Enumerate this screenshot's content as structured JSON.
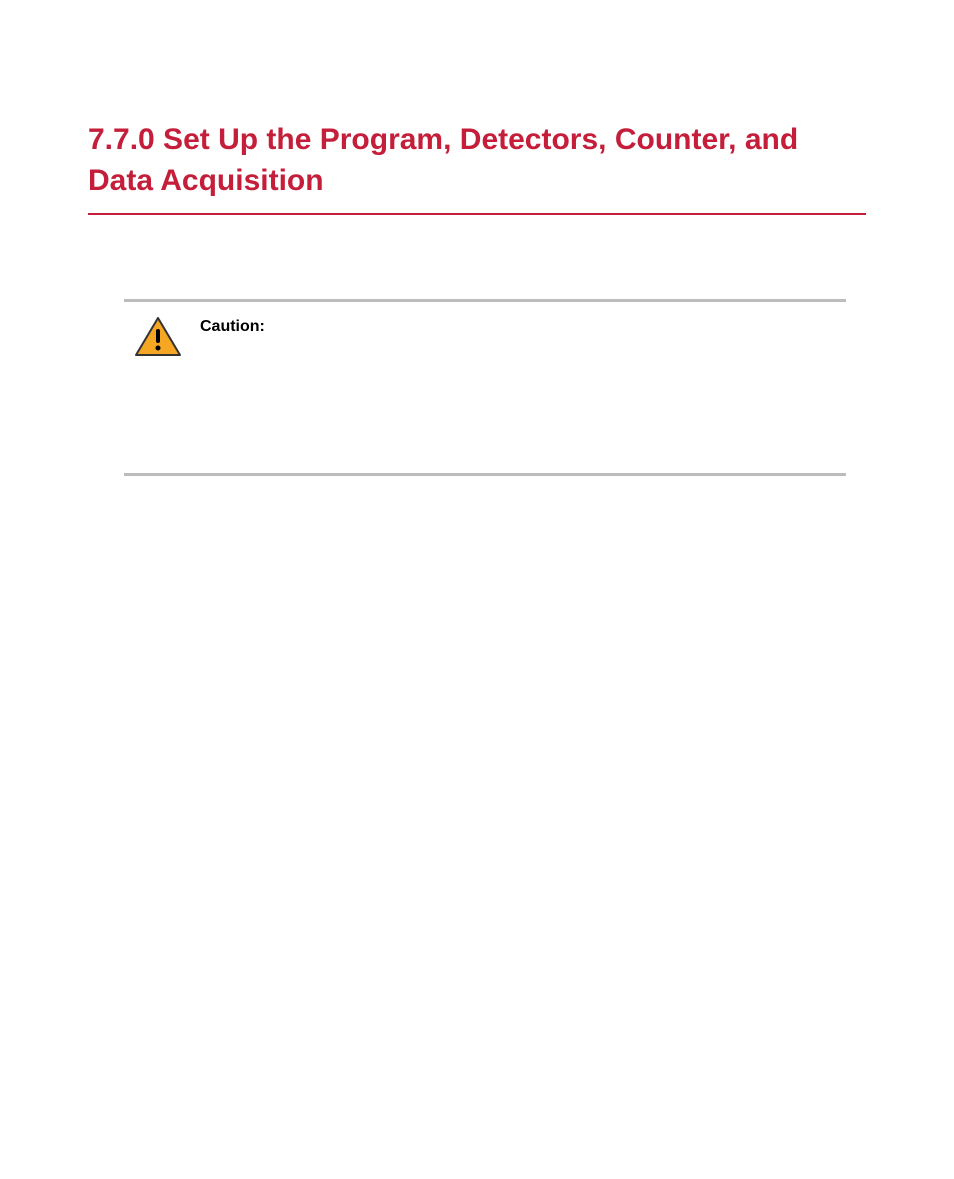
{
  "section": {
    "title": "7.7.0 Set Up the Program, Detectors, Counter, and Data Acquisition"
  },
  "caution": {
    "label": "Caution:"
  }
}
